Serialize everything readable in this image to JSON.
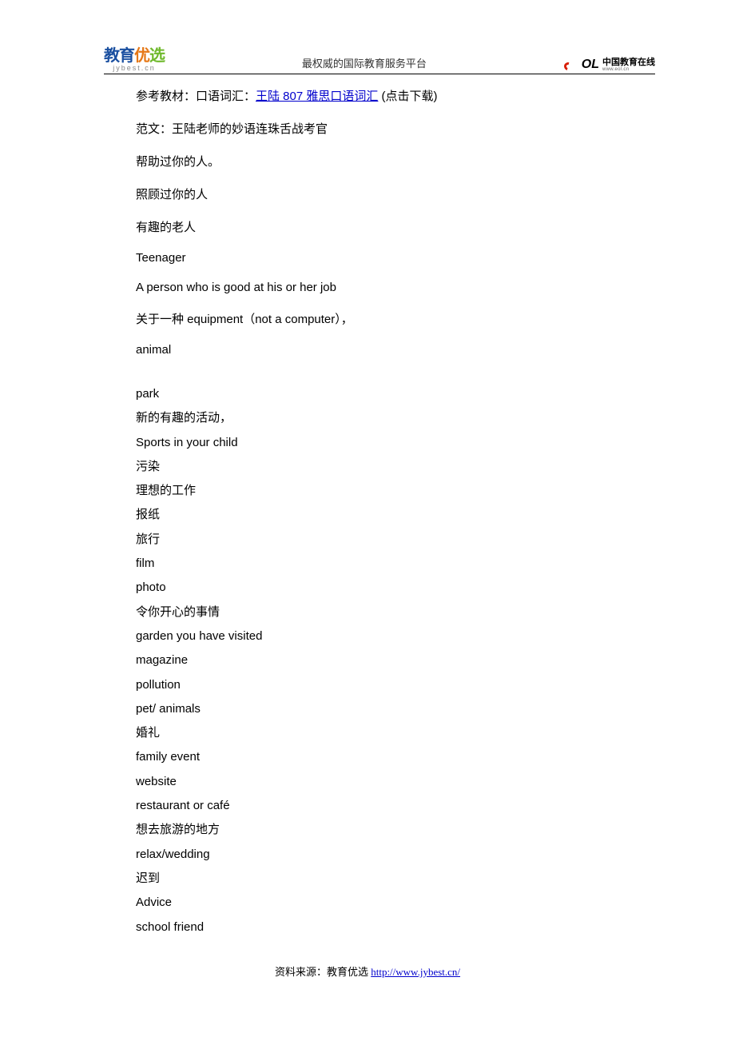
{
  "header": {
    "logo_left_main_1": "教育",
    "logo_left_main_2": "优",
    "logo_left_main_3": "选",
    "logo_left_sub": "jybest.cn",
    "title": "最权威的国际教育服务平台",
    "logo_right_brand": "OL",
    "logo_right_cn": "中国教育在线",
    "logo_right_url": "www.eol.cn"
  },
  "content": {
    "line_ref_prefix": "参考教材：口语词汇：",
    "line_ref_link": "王陆 807 雅思口语词汇",
    "line_ref_suffix": " (点击下载)",
    "line_fanwen": "范文：王陆老师的妙语连珠舌战考官",
    "line_help": "帮助过你的人。",
    "line_care": "照顾过你的人",
    "line_oldman": "有趣的老人",
    "line_teen": "Teenager",
    "line_goodjob": "A person who is good at his or her job",
    "line_equip": "关于一种 equipment（not a computer），",
    "line_animal": "animal",
    "list": [
      "park",
      "新的有趣的活动，",
      "Sports in your child",
      "污染",
      "理想的工作",
      "报纸",
      "旅行",
      "film",
      "photo",
      "令你开心的事情",
      "garden you have visited",
      "magazine",
      "pollution",
      "pet/ animals",
      "婚礼",
      "family event",
      "website",
      "restaurant or café",
      "想去旅游的地方",
      "relax/wedding",
      "迟到",
      "Advice",
      "school friend"
    ]
  },
  "footer": {
    "label": "资料来源：教育优选 ",
    "url": "http://www.jybest.cn/"
  }
}
